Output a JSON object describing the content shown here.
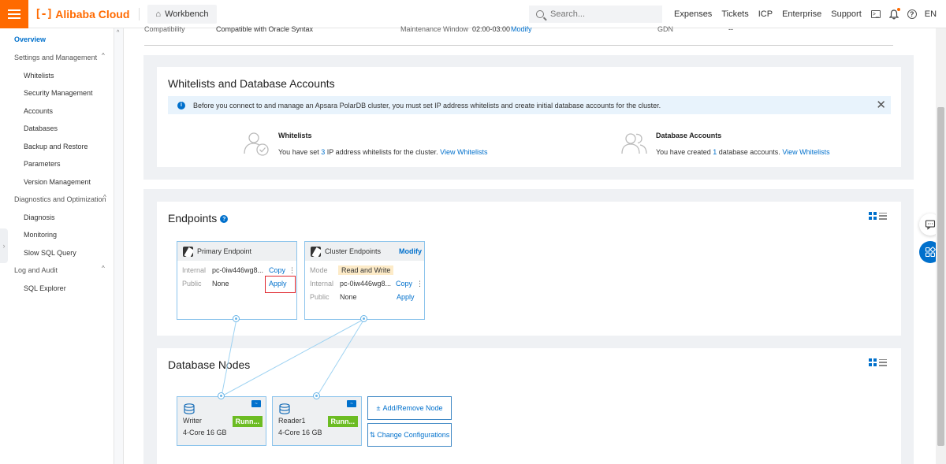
{
  "topbar": {
    "brand": "Alibaba Cloud",
    "brand_mark": "[-]",
    "workbench": "Workbench",
    "search_placeholder": "Search...",
    "links": [
      "Expenses",
      "Tickets",
      "ICP",
      "Enterprise",
      "Support"
    ],
    "lang": "EN"
  },
  "sidebar": {
    "overview": "Overview",
    "groups": {
      "settings": "Settings and Management",
      "diagnostics": "Diagnostics and Optimization",
      "log": "Log and Audit"
    },
    "settings_items": [
      "Whitelists",
      "Security Management",
      "Accounts",
      "Databases",
      "Backup and Restore",
      "Parameters",
      "Version Management"
    ],
    "diagnostics_items": [
      "Diagnosis",
      "Monitoring",
      "Slow SQL Query"
    ],
    "log_items": [
      "SQL Explorer"
    ]
  },
  "info_row": {
    "compat_label": "Compatibility",
    "compat_value": "Compatible with Oracle Syntax",
    "maint_label": "Maintenance Window",
    "maint_value": "02:00-03:00",
    "maint_link": "Modify",
    "gdn_label": "GDN",
    "gdn_value": "--"
  },
  "whitelists_card": {
    "title": "Whitelists and Database Accounts",
    "notice": "Before you connect to and manage an Apsara PolarDB cluster, you must set IP address whitelists and create initial database accounts for the cluster.",
    "whitelists": {
      "title": "Whitelists",
      "text_before": "You have set ",
      "count": "3",
      "text_after": " IP address whitelists for the cluster. ",
      "link": "View Whitelists"
    },
    "accounts": {
      "title": "Database Accounts",
      "text_before": "You have created ",
      "count": "1",
      "text_after": " database accounts. ",
      "link": "View Whitelists"
    }
  },
  "endpoints": {
    "title": "Endpoints",
    "help": "?",
    "primary": {
      "title": "Primary Endpoint",
      "internal_label": "Internal",
      "internal_value": "pc-0iw446wg8...",
      "internal_action": "Copy",
      "public_label": "Public",
      "public_value": "None",
      "public_action": "Apply"
    },
    "cluster": {
      "title": "Cluster Endpoints",
      "modify": "Modify",
      "mode_label": "Mode",
      "mode_value": "Read and Write",
      "internal_label": "Internal",
      "internal_value": "pc-0iw446wg8...",
      "internal_action": "Copy",
      "public_label": "Public",
      "public_value": "None",
      "public_action": "Apply"
    }
  },
  "nodes": {
    "title": "Database Nodes",
    "writer": {
      "name": "Writer",
      "spec": "4-Core 16 GB",
      "status": "Runn..."
    },
    "reader": {
      "name": "Reader1",
      "spec": "4-Core 16 GB",
      "status": "Runn..."
    },
    "add_remove": "Add/Remove Node",
    "change_config": "Change Configurations"
  },
  "colors": {
    "brand": "#ff6a00",
    "link": "#0070cc",
    "running": "#6cbc23",
    "highlight": "#e0262e"
  }
}
